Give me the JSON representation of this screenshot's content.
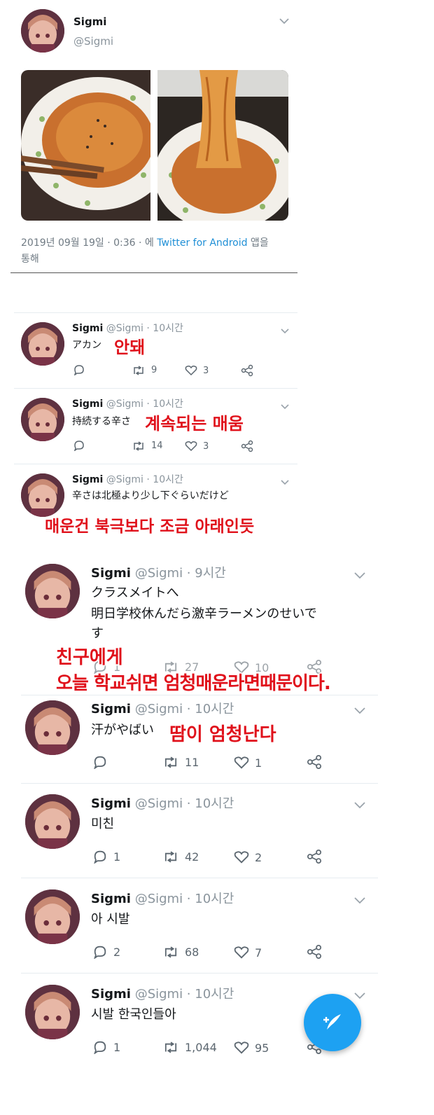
{
  "main_tweet": {
    "name": "Sigmi",
    "handle": "@Sigmi",
    "meta_prefix": "2019년 09월 19일 · 0:36 · 에 ",
    "meta_link": "Twitter for Android",
    "meta_suffix": " 앱을",
    "meta_line2": "통해"
  },
  "replies": [
    {
      "name": "Sigmi",
      "handle": "@Sigmi · 10시간",
      "text": "アカン",
      "overlay": "안돼",
      "reply": "",
      "retweets": "9",
      "likes": "3"
    },
    {
      "name": "Sigmi",
      "handle": "@Sigmi · 10시간",
      "text": "持続する辛さ",
      "overlay": "계속되는 매움",
      "reply": "",
      "retweets": "14",
      "likes": "3"
    },
    {
      "name": "Sigmi",
      "handle": "@Sigmi · 10시간",
      "text": "辛さは北極より少し下ぐらいだけど",
      "overlay": "매운건 북극보다 조금 아래인듯"
    },
    {
      "name": "Sigmi",
      "handle": "@Sigmi · 9시간",
      "text1": "クラスメイトへ",
      "text2": "明日学校休んだら激辛ラーメンのせいで",
      "text3": "す",
      "overlay1": "친구에게",
      "overlay2": "오늘 학교쉬면 엄청매운라면때문이다.",
      "reply": "1",
      "retweets": "27",
      "likes": "10"
    },
    {
      "name": "Sigmi",
      "handle": "@Sigmi · 10시간",
      "text": "汗がやばい",
      "overlay": "땀이 엄청난다",
      "reply": "",
      "retweets": "11",
      "likes": "1"
    },
    {
      "name": "Sigmi",
      "handle": "@Sigmi · 10시간",
      "text": "미친",
      "reply": "1",
      "retweets": "42",
      "likes": "2"
    },
    {
      "name": "Sigmi",
      "handle": "@Sigmi · 10시간",
      "text": "아 시발",
      "reply": "2",
      "retweets": "68",
      "likes": "7"
    },
    {
      "name": "Sigmi",
      "handle": "@Sigmi · 10시간",
      "text": "시발 한국인들아",
      "reply": "1",
      "retweets": "1,044",
      "likes": "95"
    }
  ],
  "colors": {
    "accent": "#1da1f2",
    "overlay_red": "#e0111b",
    "muted": "#8a949c"
  },
  "icons": [
    "chevron-down-icon",
    "reply-icon",
    "retweet-icon",
    "like-icon",
    "share-icon",
    "compose-tweet-icon"
  ]
}
